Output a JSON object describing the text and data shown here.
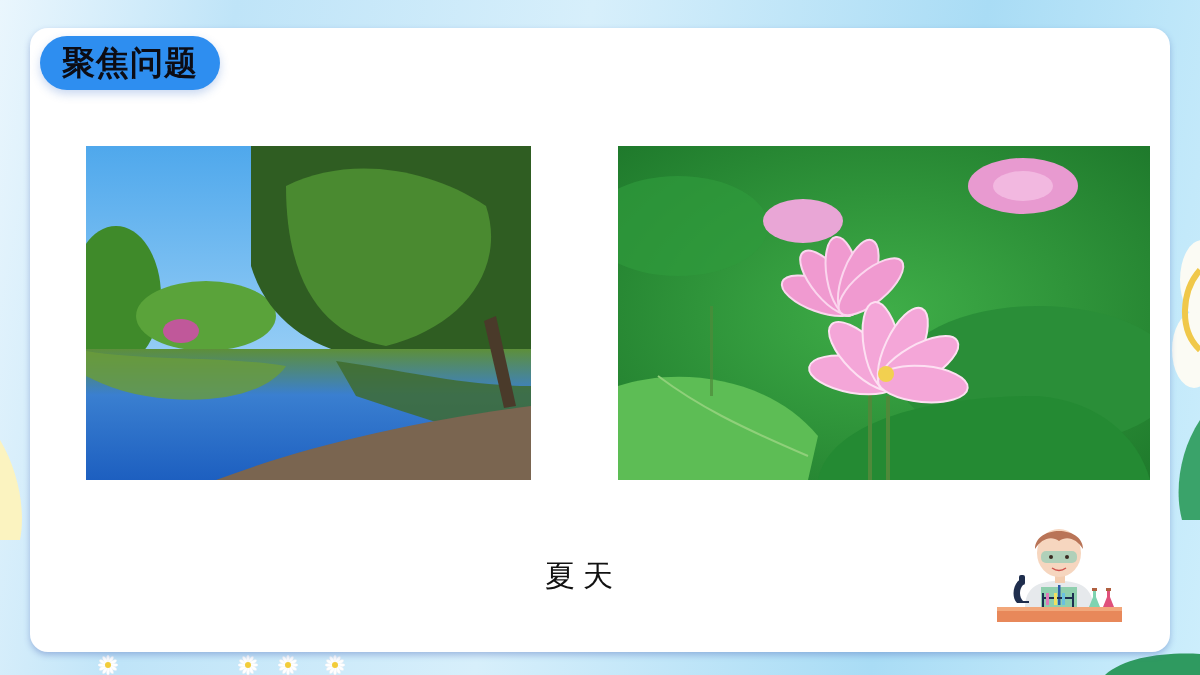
{
  "slide": {
    "title": "聚焦问题",
    "caption": "夏天"
  }
}
